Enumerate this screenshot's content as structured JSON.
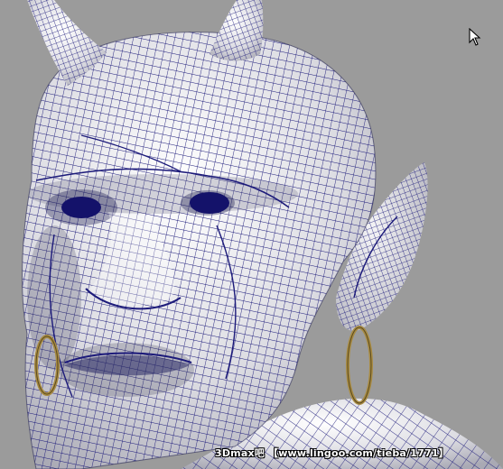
{
  "viewport": {
    "background_color": "#9b9b9b",
    "wire_color": "#1c1a7a",
    "skin_color": "#e9e9ec",
    "earring_color": "#a88b42",
    "cursor_icon": "arrow-cursor-icon"
  },
  "watermark": {
    "text": "3Dmax吧 【www.lingoo.com/tieba/1771】"
  }
}
